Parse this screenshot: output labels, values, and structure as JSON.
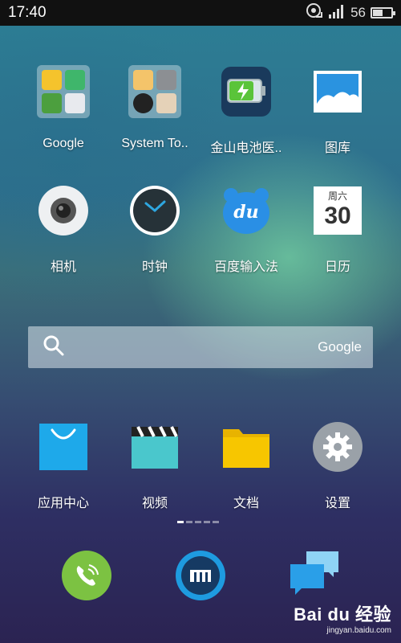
{
  "status_bar": {
    "time": "17:40",
    "battery_percent": "56",
    "battery_level": 0.56,
    "icons": [
      "nfc-icon",
      "signal-icon",
      "battery-icon"
    ]
  },
  "apps_row1": [
    {
      "label": "Google",
      "icon": "google-folder-icon"
    },
    {
      "label": "System To..",
      "icon": "system-tools-folder-icon"
    },
    {
      "label": "金山电池医..",
      "icon": "battery-doctor-icon"
    },
    {
      "label": "图库",
      "icon": "gallery-icon"
    }
  ],
  "apps_row2": [
    {
      "label": "相机",
      "icon": "camera-icon"
    },
    {
      "label": "时钟",
      "icon": "clock-icon"
    },
    {
      "label": "百度输入法",
      "icon": "baidu-ime-icon",
      "icon_text": "du"
    },
    {
      "label": "日历",
      "icon": "calendar-icon",
      "weekday": "周六",
      "day": "30"
    }
  ],
  "search": {
    "brand": "Google",
    "icon": "search-icon"
  },
  "apps_row3": [
    {
      "label": "应用中心",
      "icon": "app-center-icon"
    },
    {
      "label": "视频",
      "icon": "video-icon"
    },
    {
      "label": "文档",
      "icon": "documents-icon"
    },
    {
      "label": "设置",
      "icon": "settings-icon"
    }
  ],
  "page_indicator": {
    "pages": 5,
    "active": 0
  },
  "dock": [
    {
      "icon": "phone-icon"
    },
    {
      "icon": "browser-icon"
    },
    {
      "icon": "messages-icon"
    }
  ],
  "watermark": {
    "logo": "Bai du 经验",
    "url": "jingyan.baidu.com"
  },
  "colors": {
    "status_bar": "#111111",
    "phone_green": "#7cc242",
    "browser_blue": "#1e9be0",
    "folder_yellow": "#f7c600",
    "video_teal": "#4ac7cc",
    "app_center_blue": "#1ea9ea"
  }
}
